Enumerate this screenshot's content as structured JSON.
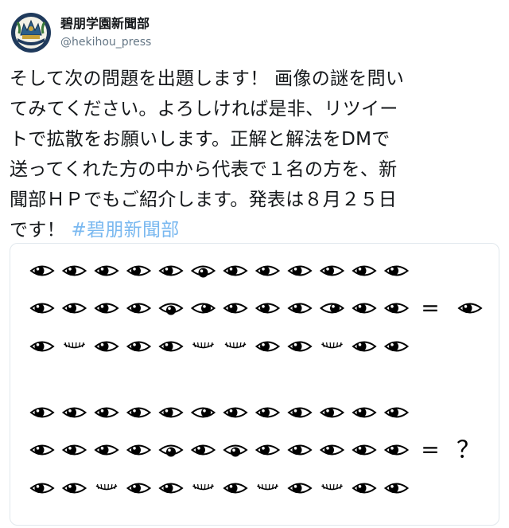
{
  "account": {
    "display_name": "碧朋学園新聞部",
    "handle": "@hekihou_press",
    "avatar_icon": "school-crest-icon"
  },
  "tweet": {
    "lines": [
      "そして次の問題を出題します！ 画像の謎を問い",
      "てみてください。よろしければ是非、リツイー",
      "トで拡散をお願いします。正解と解法をDMで",
      "送ってくれた方の中から代表で１名の方を、新",
      "聞部ＨＰでもご紹介します。発表は８月２５日"
    ],
    "last_line_text": "です！ ",
    "hashtag": "#碧朋新聞部"
  },
  "puzzle": {
    "rows": [
      [
        "L",
        "L",
        "L",
        "L",
        "L",
        "D",
        "L",
        "L",
        "L",
        "L",
        "L",
        "L"
      ],
      [
        "L",
        "L",
        "L",
        "L",
        "D",
        "R",
        "L",
        "L",
        "L",
        "R",
        "L",
        "L"
      ],
      [
        "L",
        "C",
        "L",
        "L",
        "L",
        "C",
        "C",
        "L",
        "L",
        "C",
        "L",
        "L"
      ],
      [
        "L",
        "L",
        "L",
        "L",
        "L",
        "R",
        "L",
        "L",
        "L",
        "L",
        "L",
        "L"
      ],
      [
        "L",
        "L",
        "L",
        "L",
        "D",
        "L",
        "D",
        "L",
        "L",
        "L",
        "L",
        "L"
      ],
      [
        "L",
        "L",
        "C",
        "L",
        "L",
        "C",
        "L",
        "C",
        "L",
        "C",
        "L",
        "L"
      ]
    ],
    "equals_symbol": "=",
    "answer_top": "eye",
    "answer_bottom": "？",
    "colors": {
      "ink": "#000000",
      "frame": "#e1e8ed"
    }
  }
}
